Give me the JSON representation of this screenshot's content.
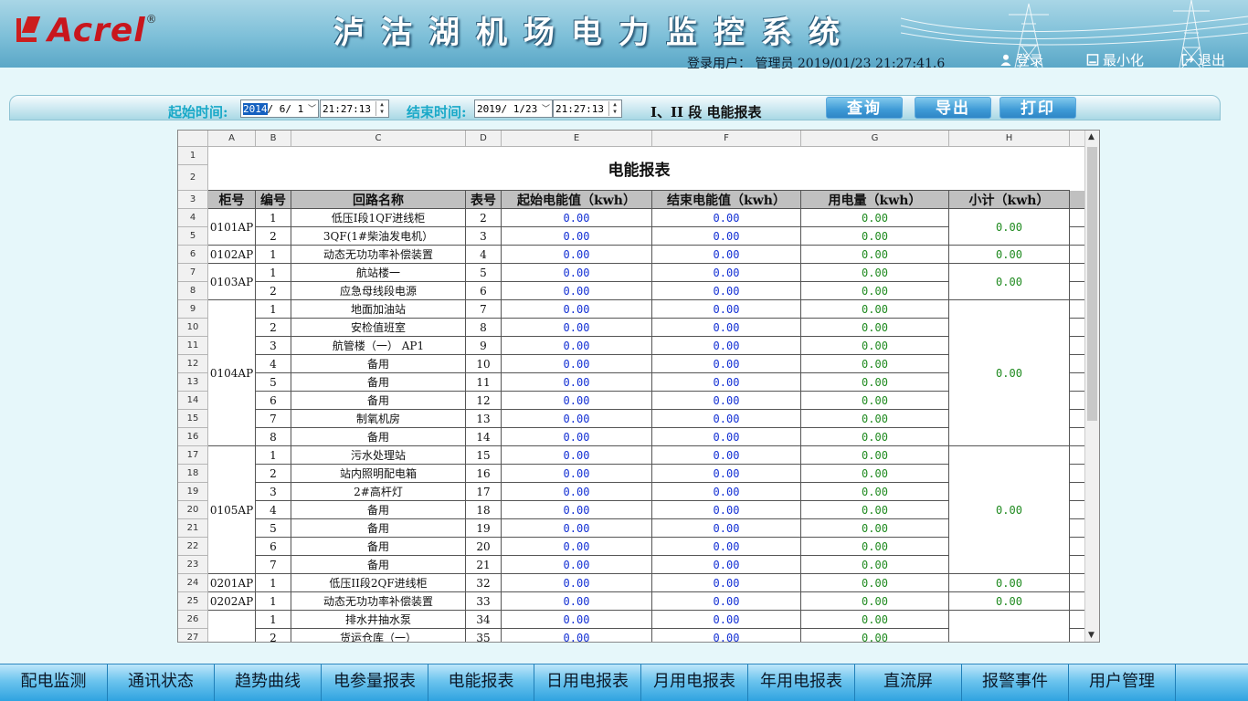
{
  "header": {
    "logo_text": "Acrel",
    "logo_reg": "®",
    "title": "泸沽湖机场电力监控系统",
    "user_line": "登录用户： 管理员 2019/01/23  21:27:41.6",
    "login": "登录",
    "minimize": "最小化",
    "logout": "退出"
  },
  "toolbar": {
    "start_label": "起始时间:",
    "start_date_sel": "2014",
    "start_date_rest": "/ 6/ 1",
    "start_time": "21:27:13",
    "end_label": "结束时间:",
    "end_date": "2019/ 1/23",
    "end_time": "21:27:13",
    "report_name": "I、II 段 电能报表",
    "query": "查询",
    "export": "导出",
    "print": "打印"
  },
  "sheet": {
    "col_letters": [
      "A",
      "B",
      "C",
      "D",
      "E",
      "F",
      "G",
      "H"
    ],
    "report_title": "电能报表",
    "headers": [
      "柜号",
      "编号",
      "回路名称",
      "表号",
      "起始电能值（kwh）",
      "结束电能值（kwh）",
      "用电量（kwh）",
      "小计（kwh）"
    ],
    "rows": [
      {
        "n": "4",
        "b": "1",
        "c": "低压I段1QF进线柜",
        "d": "2",
        "e": "0.00",
        "f": "0.00",
        "g": "0.00"
      },
      {
        "n": "5",
        "b": "2",
        "c": "3QF(1#柴油发电机）",
        "d": "3",
        "e": "0.00",
        "f": "0.00",
        "g": "0.00"
      },
      {
        "n": "6",
        "b": "1",
        "c": "动态无功功率补偿装置",
        "d": "4",
        "e": "0.00",
        "f": "0.00",
        "g": "0.00"
      },
      {
        "n": "7",
        "b": "1",
        "c": "航站楼一",
        "d": "5",
        "e": "0.00",
        "f": "0.00",
        "g": "0.00"
      },
      {
        "n": "8",
        "b": "2",
        "c": "应急母线段电源",
        "d": "6",
        "e": "0.00",
        "f": "0.00",
        "g": "0.00"
      },
      {
        "n": "9",
        "b": "1",
        "c": "地面加油站",
        "d": "7",
        "e": "0.00",
        "f": "0.00",
        "g": "0.00"
      },
      {
        "n": "10",
        "b": "2",
        "c": "安检值班室",
        "d": "8",
        "e": "0.00",
        "f": "0.00",
        "g": "0.00"
      },
      {
        "n": "11",
        "b": "3",
        "c": "航管楼（一） AP1",
        "d": "9",
        "e": "0.00",
        "f": "0.00",
        "g": "0.00"
      },
      {
        "n": "12",
        "b": "4",
        "c": "备用",
        "d": "10",
        "e": "0.00",
        "f": "0.00",
        "g": "0.00"
      },
      {
        "n": "13",
        "b": "5",
        "c": "备用",
        "d": "11",
        "e": "0.00",
        "f": "0.00",
        "g": "0.00"
      },
      {
        "n": "14",
        "b": "6",
        "c": "备用",
        "d": "12",
        "e": "0.00",
        "f": "0.00",
        "g": "0.00"
      },
      {
        "n": "15",
        "b": "7",
        "c": "制氧机房",
        "d": "13",
        "e": "0.00",
        "f": "0.00",
        "g": "0.00"
      },
      {
        "n": "16",
        "b": "8",
        "c": "备用",
        "d": "14",
        "e": "0.00",
        "f": "0.00",
        "g": "0.00"
      },
      {
        "n": "17",
        "b": "1",
        "c": "污水处理站",
        "d": "15",
        "e": "0.00",
        "f": "0.00",
        "g": "0.00"
      },
      {
        "n": "18",
        "b": "2",
        "c": "站内照明配电箱",
        "d": "16",
        "e": "0.00",
        "f": "0.00",
        "g": "0.00"
      },
      {
        "n": "19",
        "b": "3",
        "c": "2#高杆灯",
        "d": "17",
        "e": "0.00",
        "f": "0.00",
        "g": "0.00"
      },
      {
        "n": "20",
        "b": "4",
        "c": "备用",
        "d": "18",
        "e": "0.00",
        "f": "0.00",
        "g": "0.00"
      },
      {
        "n": "21",
        "b": "5",
        "c": "备用",
        "d": "19",
        "e": "0.00",
        "f": "0.00",
        "g": "0.00"
      },
      {
        "n": "22",
        "b": "6",
        "c": "备用",
        "d": "20",
        "e": "0.00",
        "f": "0.00",
        "g": "0.00"
      },
      {
        "n": "23",
        "b": "7",
        "c": "备用",
        "d": "21",
        "e": "0.00",
        "f": "0.00",
        "g": "0.00"
      },
      {
        "n": "24",
        "b": "1",
        "c": "低压II段2QF进线柜",
        "d": "32",
        "e": "0.00",
        "f": "0.00",
        "g": "0.00"
      },
      {
        "n": "25",
        "b": "1",
        "c": "动态无功功率补偿装置",
        "d": "33",
        "e": "0.00",
        "f": "0.00",
        "g": "0.00"
      },
      {
        "n": "26",
        "b": "1",
        "c": "排水井抽水泵",
        "d": "34",
        "e": "0.00",
        "f": "0.00",
        "g": "0.00"
      },
      {
        "n": "27",
        "b": "2",
        "c": "货运仓库（一）",
        "d": "35",
        "e": "0.00",
        "f": "0.00",
        "g": "0.00"
      }
    ],
    "cabinets": [
      {
        "label": "0101AP",
        "start": 0,
        "span": 2,
        "subtotal": "0.00"
      },
      {
        "label": "0102AP",
        "start": 2,
        "span": 1,
        "subtotal": "0.00"
      },
      {
        "label": "0103AP",
        "start": 3,
        "span": 2,
        "subtotal": "0.00"
      },
      {
        "label": "0104AP",
        "start": 5,
        "span": 8,
        "subtotal": "0.00"
      },
      {
        "label": "0105AP",
        "start": 13,
        "span": 7,
        "subtotal": "0.00"
      },
      {
        "label": "0201AP",
        "start": 20,
        "span": 1,
        "subtotal": "0.00"
      },
      {
        "label": "0202AP",
        "start": 21,
        "span": 1,
        "subtotal": "0.00"
      },
      {
        "label": "",
        "start": 22,
        "span": 2,
        "subtotal": ""
      }
    ]
  },
  "nav": [
    "配电监测",
    "通讯状态",
    "趋势曲线",
    "电参量报表",
    "电能报表",
    "日用电报表",
    "月用电报表",
    "年用电报表",
    "直流屏",
    "报警事件",
    "用户管理"
  ]
}
